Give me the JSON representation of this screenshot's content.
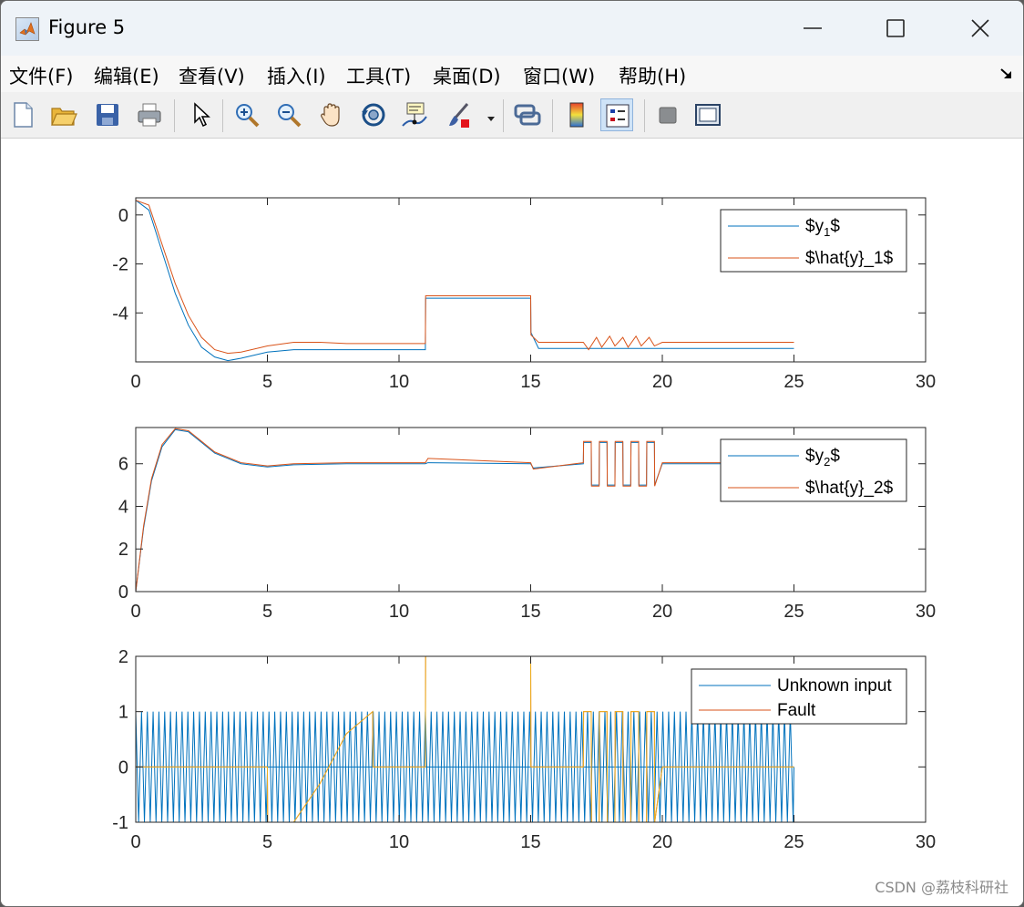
{
  "window": {
    "title": "Figure 5"
  },
  "menubar": {
    "items": [
      "文件(F)",
      "编辑(E)",
      "查看(V)",
      "插入(I)",
      "工具(T)",
      "桌面(D)",
      "窗口(W)",
      "帮助(H)"
    ]
  },
  "toolbar": {
    "buttons": [
      {
        "name": "new-figure-icon"
      },
      {
        "name": "open-file-icon"
      },
      {
        "name": "save-icon"
      },
      {
        "name": "print-icon"
      },
      {
        "name": "edit-plot-arrow-icon"
      },
      {
        "name": "zoom-in-icon"
      },
      {
        "name": "zoom-out-icon"
      },
      {
        "name": "pan-hand-icon"
      },
      {
        "name": "rotate-3d-icon"
      },
      {
        "name": "data-cursor-icon"
      },
      {
        "name": "brush-icon"
      },
      {
        "name": "link-plot-icon"
      },
      {
        "name": "insert-colorbar-icon"
      },
      {
        "name": "insert-legend-icon"
      },
      {
        "name": "hide-plot-tools-icon"
      },
      {
        "name": "show-plot-tools-icon"
      }
    ],
    "active": "insert-legend-icon"
  },
  "watermark": "CSDN @荔枝科研社",
  "colors": {
    "series_blue": "#0072BD",
    "series_red": "#D95319",
    "series_yellow": "#EDB120"
  },
  "chart_data": [
    {
      "type": "line",
      "x_ticks": [
        "0",
        "5",
        "10",
        "15",
        "20",
        "25",
        "30"
      ],
      "y_ticks": [
        "0",
        "-2",
        "-4"
      ],
      "xlim": [
        0,
        30
      ],
      "ylim": [
        -6,
        0.7
      ],
      "grid": false,
      "legend_position": "top-right",
      "series": [
        {
          "name": "$y_1$",
          "legend_main": "$y",
          "legend_sub": "1",
          "legend_tail": "$",
          "x": [
            0,
            0.5,
            1,
            1.5,
            2,
            2.5,
            3,
            3.5,
            4,
            5,
            6,
            7,
            8,
            10,
            11,
            11.01,
            15,
            15.01,
            15.3,
            20,
            25
          ],
          "y": [
            0.6,
            0.2,
            -1.5,
            -3.2,
            -4.5,
            -5.4,
            -5.8,
            -5.95,
            -5.85,
            -5.6,
            -5.5,
            -5.5,
            -5.5,
            -5.5,
            -5.5,
            -3.4,
            -3.4,
            -4.8,
            -5.45,
            -5.45,
            -5.45
          ]
        },
        {
          "name": "$\\hat{y}_1$",
          "legend_text": "$\\hat{y}_1$",
          "x": [
            0,
            0.5,
            1,
            1.5,
            2,
            2.5,
            3,
            3.5,
            4,
            5,
            6,
            7,
            8,
            10,
            11,
            11.01,
            15,
            15.01,
            15.3,
            17,
            17.2,
            17.5,
            17.7,
            18,
            18.2,
            18.5,
            18.7,
            19,
            19.2,
            19.5,
            19.7,
            20,
            25
          ],
          "y": [
            0.6,
            0.4,
            -1.2,
            -2.8,
            -4.1,
            -5.0,
            -5.5,
            -5.65,
            -5.6,
            -5.35,
            -5.2,
            -5.2,
            -5.25,
            -5.25,
            -5.25,
            -3.3,
            -3.3,
            -4.9,
            -5.2,
            -5.2,
            -5.5,
            -5.0,
            -5.4,
            -4.95,
            -5.35,
            -5.0,
            -5.4,
            -4.95,
            -5.35,
            -5.0,
            -5.35,
            -5.2,
            -5.2
          ]
        }
      ]
    },
    {
      "type": "line",
      "x_ticks": [
        "0",
        "5",
        "10",
        "15",
        "20",
        "25",
        "30"
      ],
      "y_ticks": [
        "0",
        "2",
        "4",
        "6"
      ],
      "xlim": [
        0,
        30
      ],
      "ylim": [
        0,
        7.7
      ],
      "grid": false,
      "legend_position": "top-right",
      "series": [
        {
          "name": "$y_2$",
          "legend_main": "$y",
          "legend_sub": "2",
          "legend_tail": "$",
          "x": [
            0,
            0.3,
            0.6,
            1,
            1.5,
            2,
            2.5,
            3,
            4,
            5,
            6,
            8,
            11,
            11.1,
            15,
            15.1,
            17,
            17.01,
            17.3,
            17.31,
            17.6,
            17.61,
            17.9,
            17.91,
            18.2,
            18.21,
            18.5,
            18.51,
            18.8,
            18.81,
            19.1,
            19.11,
            19.4,
            19.41,
            19.7,
            19.71,
            20,
            25
          ],
          "y": [
            0,
            3.0,
            5.2,
            6.8,
            7.6,
            7.5,
            7.0,
            6.5,
            6.0,
            5.85,
            5.95,
            6.0,
            6.0,
            6.05,
            6.0,
            5.8,
            6.0,
            7.0,
            7.0,
            5.0,
            5.0,
            7.0,
            7.0,
            5.0,
            5.0,
            7.0,
            7.0,
            5.0,
            5.0,
            7.0,
            7.0,
            5.0,
            5.0,
            7.0,
            7.0,
            5.0,
            6.0,
            6.0
          ]
        },
        {
          "name": "$\\hat{y}_2$",
          "legend_text": "$\\hat{y}_2$",
          "x": [
            0,
            0.3,
            0.6,
            1,
            1.5,
            2,
            2.5,
            3,
            4,
            5,
            6,
            8,
            11,
            11.1,
            15,
            15.1,
            17,
            17.01,
            17.3,
            17.31,
            17.6,
            17.61,
            17.9,
            17.91,
            18.2,
            18.21,
            18.5,
            18.51,
            18.8,
            18.81,
            19.1,
            19.11,
            19.4,
            19.41,
            19.7,
            19.71,
            20,
            25
          ],
          "y": [
            0,
            3.1,
            5.3,
            6.9,
            7.65,
            7.55,
            7.05,
            6.55,
            6.05,
            5.9,
            6.0,
            6.05,
            6.05,
            6.25,
            6.05,
            5.75,
            6.05,
            7.05,
            7.05,
            4.95,
            4.95,
            7.05,
            7.05,
            4.95,
            4.95,
            7.05,
            7.05,
            4.95,
            4.95,
            7.05,
            7.05,
            4.95,
            4.95,
            7.05,
            7.05,
            4.95,
            6.05,
            6.05
          ]
        }
      ]
    },
    {
      "type": "line",
      "x_ticks": [
        "0",
        "5",
        "10",
        "15",
        "20",
        "25",
        "30"
      ],
      "y_ticks": [
        "-1",
        "0",
        "1",
        "2"
      ],
      "xlim": [
        0,
        30
      ],
      "ylim": [
        -1,
        2
      ],
      "grid": false,
      "legend_position": "top-right",
      "series": [
        {
          "name": "Unknown input",
          "legend_text": "Unknown input",
          "oscillation": {
            "amplitude": 1,
            "period": 0.22,
            "x_range": [
              0,
              25
            ]
          }
        },
        {
          "name": "Fault",
          "legend_text": "Fault",
          "x": [
            0,
            5,
            5.01,
            6,
            7,
            8,
            9,
            9.01,
            11,
            11.01,
            15,
            15.01,
            17,
            17.01,
            17.3,
            17.31,
            17.6,
            17.61,
            17.9,
            17.91,
            18.2,
            18.21,
            18.5,
            18.51,
            18.8,
            18.81,
            19.1,
            19.11,
            19.4,
            19.41,
            19.7,
            19.71,
            20,
            25
          ],
          "y": [
            0,
            0,
            -1,
            -1,
            -0.3,
            0.6,
            1,
            0,
            0,
            2,
            2,
            0,
            0,
            1,
            1,
            -1,
            -1,
            1,
            1,
            -1,
            -1,
            1,
            1,
            -1,
            -1,
            1,
            1,
            -1,
            -1,
            1,
            1,
            -1,
            0,
            0
          ]
        }
      ]
    }
  ]
}
